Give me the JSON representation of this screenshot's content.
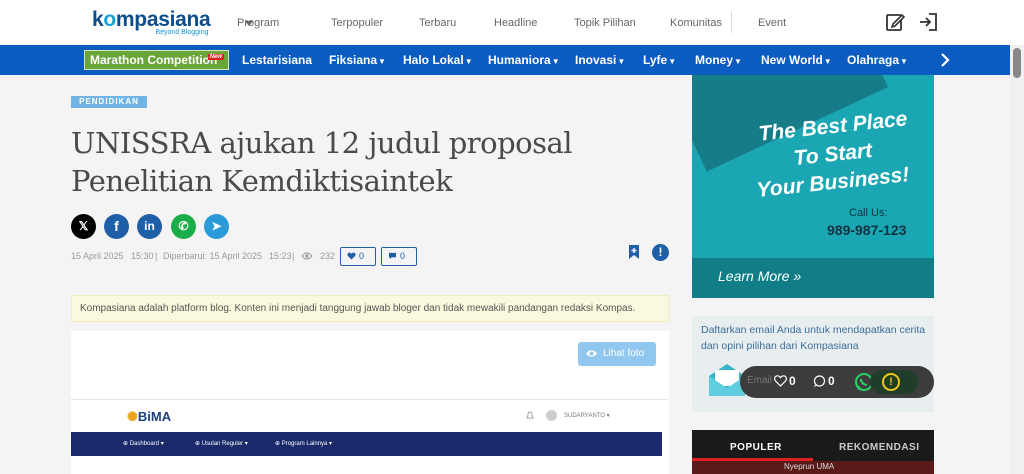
{
  "logo": {
    "name_a": "k",
    "name_o": "o",
    "name_b": "mpasiana",
    "tagline": "Beyond Blogging"
  },
  "topnav": {
    "items": [
      "Program",
      "Terpopuler",
      "Terbaru",
      "Headline",
      "Topik Pilihan",
      "Komunitas",
      "Event"
    ]
  },
  "catbar": {
    "marathon": "Marathon Competition",
    "marathon_badge": "New",
    "items": [
      {
        "label": "Lestarisiana",
        "dropdown": false
      },
      {
        "label": "Fiksiana",
        "dropdown": true
      },
      {
        "label": "Halo Lokal",
        "dropdown": true
      },
      {
        "label": "Humaniora",
        "dropdown": true
      },
      {
        "label": "Inovasi",
        "dropdown": true
      },
      {
        "label": "Lyfe",
        "dropdown": true
      },
      {
        "label": "Money",
        "dropdown": true
      },
      {
        "label": "New World",
        "dropdown": true
      },
      {
        "label": "Olahraga",
        "dropdown": true
      }
    ],
    "caret": "▼"
  },
  "article": {
    "category": "PENDIDIKAN",
    "title_line1": "UNISSRA ajukan 12 judul proposal",
    "title_line2": "Penelitian Kemdiktisaintek",
    "share": [
      "x-icon",
      "facebook-icon",
      "linkedin-icon",
      "whatsapp-icon",
      "telegram-icon"
    ],
    "share_labels": [
      "𝕏",
      "f",
      "in",
      "✆",
      "➤"
    ],
    "date": "15 April 2025",
    "time": "15:30",
    "updated_label": "Diperbarui: 15 April 2025",
    "updated_time": "15:23",
    "sep": "|",
    "views": "232",
    "likes": "0",
    "comments": "0",
    "report_label": "!",
    "disclaimer": "Kompasiana adalah platform blog. Konten ini menjadi tanggung jawab bloger dan tidak mewakili pandangan redaksi Kompas.",
    "lihat_foto": "Lihat foto"
  },
  "bima": {
    "logo_b": "B",
    "logo_rest": "iMA",
    "user": "SUDARYANTO ▾",
    "nav": [
      "⊕ Dashboard ▾",
      "⊕ Usulan Reguler ▾",
      "⊕ Program Lainnya ▾"
    ]
  },
  "ad": {
    "line1": "The Best Place",
    "line2": "To Start",
    "line3": "Your Business!",
    "call_us": "Call Us:",
    "phone": "989-987-123",
    "learn_more": "Learn More »"
  },
  "newsletter": {
    "text": "Daftarkan email Anda untuk mendapatkan cerita dan opini pilihan dari Kompasiana",
    "email_placeholder": "Email"
  },
  "floatbar": {
    "likes": "0",
    "comments": "0",
    "warn": "!"
  },
  "tabs": {
    "populer": "POPULER",
    "rekomendasi": "REKOMENDASI",
    "strip_text": "Nyeprun UMA"
  },
  "colors": {
    "brand_blue": "#0a5cc0",
    "marathon_green": "#6aa53a",
    "ad_teal": "#1aa7b3"
  }
}
